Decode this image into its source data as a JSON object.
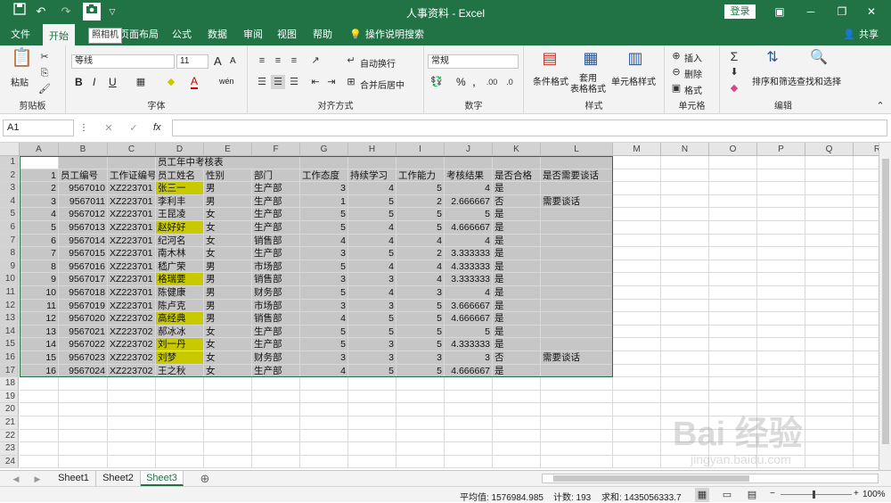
{
  "window": {
    "title": "人事资料 - Excel",
    "login_label": "登录",
    "tooltip": "照相机"
  },
  "tabs": [
    "文件",
    "开始",
    "插入",
    "页面布局",
    "公式",
    "数据",
    "审阅",
    "视图",
    "帮助"
  ],
  "active_tab": "开始",
  "tell_me": "操作说明搜索",
  "share": "共享",
  "ribbon": {
    "clipboard": {
      "paste": "粘贴",
      "label": "剪贴板"
    },
    "font": {
      "name": "等线",
      "size": "11",
      "label": "字体",
      "bold": "B",
      "italic": "I",
      "underline": "U",
      "grow": "A",
      "shrink": "A",
      "font_color": "A",
      "phonetic": "wén"
    },
    "alignment": {
      "wrap": "自动换行",
      "merge": "合并后居中",
      "label": "对齐方式"
    },
    "number": {
      "format": "常规",
      "label": "数字",
      "percent": "%",
      "comma": ","
    },
    "styles": {
      "cond": "条件格式",
      "table": "套用\n表格格式",
      "cell": "单元格样式",
      "label": "样式"
    },
    "cells": {
      "insert": "插入",
      "delete": "删除",
      "format": "格式",
      "label": "单元格"
    },
    "editing": {
      "sort": "排序和筛选",
      "find": "查找和选择",
      "label": "编辑"
    }
  },
  "formula_bar": {
    "name_box": "A1",
    "fx": "fx",
    "value": ""
  },
  "columns": [
    "A",
    "B",
    "C",
    "D",
    "E",
    "F",
    "G",
    "H",
    "I",
    "J",
    "K",
    "L",
    "M",
    "N",
    "O",
    "P",
    "Q",
    "R"
  ],
  "rows_count": 24,
  "sheet": {
    "title": "员工年中考核表",
    "headers": [
      "1",
      "员工编号",
      "工作证编号",
      "员工姓名",
      "性别",
      "部门",
      "工作态度",
      "持续学习",
      "工作能力",
      "考核结果",
      "是否合格",
      "是否需要谈话"
    ],
    "rows": [
      [
        "2",
        "9567010",
        "XZ223701",
        "张三一",
        "男",
        "生产部",
        "3",
        "4",
        "5",
        "4",
        "是",
        ""
      ],
      [
        "3",
        "9567011",
        "XZ223701",
        "李利丰",
        "男",
        "生产部",
        "1",
        "5",
        "2",
        "2.666667",
        "否",
        "需要谈话"
      ],
      [
        "4",
        "9567012",
        "XZ223701",
        "王昆凌",
        "女",
        "生产部",
        "5",
        "5",
        "5",
        "5",
        "是",
        ""
      ],
      [
        "5",
        "9567013",
        "XZ223701",
        "赵好好",
        "女",
        "生产部",
        "5",
        "4",
        "5",
        "4.666667",
        "是",
        ""
      ],
      [
        "6",
        "9567014",
        "XZ223701",
        "纪河名",
        "女",
        "销售部",
        "4",
        "4",
        "4",
        "4",
        "是",
        ""
      ],
      [
        "7",
        "9567015",
        "XZ223701",
        "南木林",
        "女",
        "生产部",
        "3",
        "5",
        "2",
        "3.333333",
        "是",
        ""
      ],
      [
        "8",
        "9567016",
        "XZ223701",
        "嵇广荣",
        "男",
        "市场部",
        "5",
        "4",
        "4",
        "4.333333",
        "是",
        ""
      ],
      [
        "9",
        "9567017",
        "XZ223701",
        "格瑞要",
        "男",
        "销售部",
        "3",
        "3",
        "4",
        "3.333333",
        "是",
        ""
      ],
      [
        "10",
        "9567018",
        "XZ223701",
        "陈健康",
        "男",
        "财务部",
        "5",
        "4",
        "3",
        "4",
        "是",
        ""
      ],
      [
        "11",
        "9567019",
        "XZ223701",
        "陈卢克",
        "男",
        "市场部",
        "3",
        "3",
        "5",
        "3.666667",
        "是",
        ""
      ],
      [
        "12",
        "9567020",
        "XZ223702",
        "高经典",
        "男",
        "销售部",
        "4",
        "5",
        "5",
        "4.666667",
        "是",
        ""
      ],
      [
        "13",
        "9567021",
        "XZ223702",
        "郝冰冰",
        "女",
        "生产部",
        "5",
        "5",
        "5",
        "5",
        "是",
        ""
      ],
      [
        "14",
        "9567022",
        "XZ223702",
        "刘一丹",
        "女",
        "生产部",
        "5",
        "3",
        "5",
        "4.333333",
        "是",
        ""
      ],
      [
        "15",
        "9567023",
        "XZ223702",
        "刘梦",
        "女",
        "财务部",
        "3",
        "3",
        "3",
        "3",
        "否",
        "需要谈话"
      ],
      [
        "16",
        "9567024",
        "XZ223702",
        "王之秋",
        "女",
        "生产部",
        "4",
        "5",
        "5",
        "4.666667",
        "是",
        ""
      ]
    ],
    "highlighted_names": [
      "张三一",
      "赵好好",
      "格瑞要",
      "高经典",
      "刘一丹",
      "刘梦"
    ]
  },
  "sheet_tabs": [
    "Sheet1",
    "Sheet2",
    "Sheet3"
  ],
  "active_sheet": "Sheet3",
  "status": {
    "average": "平均值: 1576984.985",
    "count": "计数: 193",
    "sum": "求和: 1435056333.7",
    "zoom": "100%"
  },
  "watermark": {
    "text": "Bai 经验",
    "url": "jingyan.baidu.com"
  },
  "colors": {
    "brand": "#217346",
    "highlight": "#c9c900",
    "selection": "#c6c6c6"
  }
}
